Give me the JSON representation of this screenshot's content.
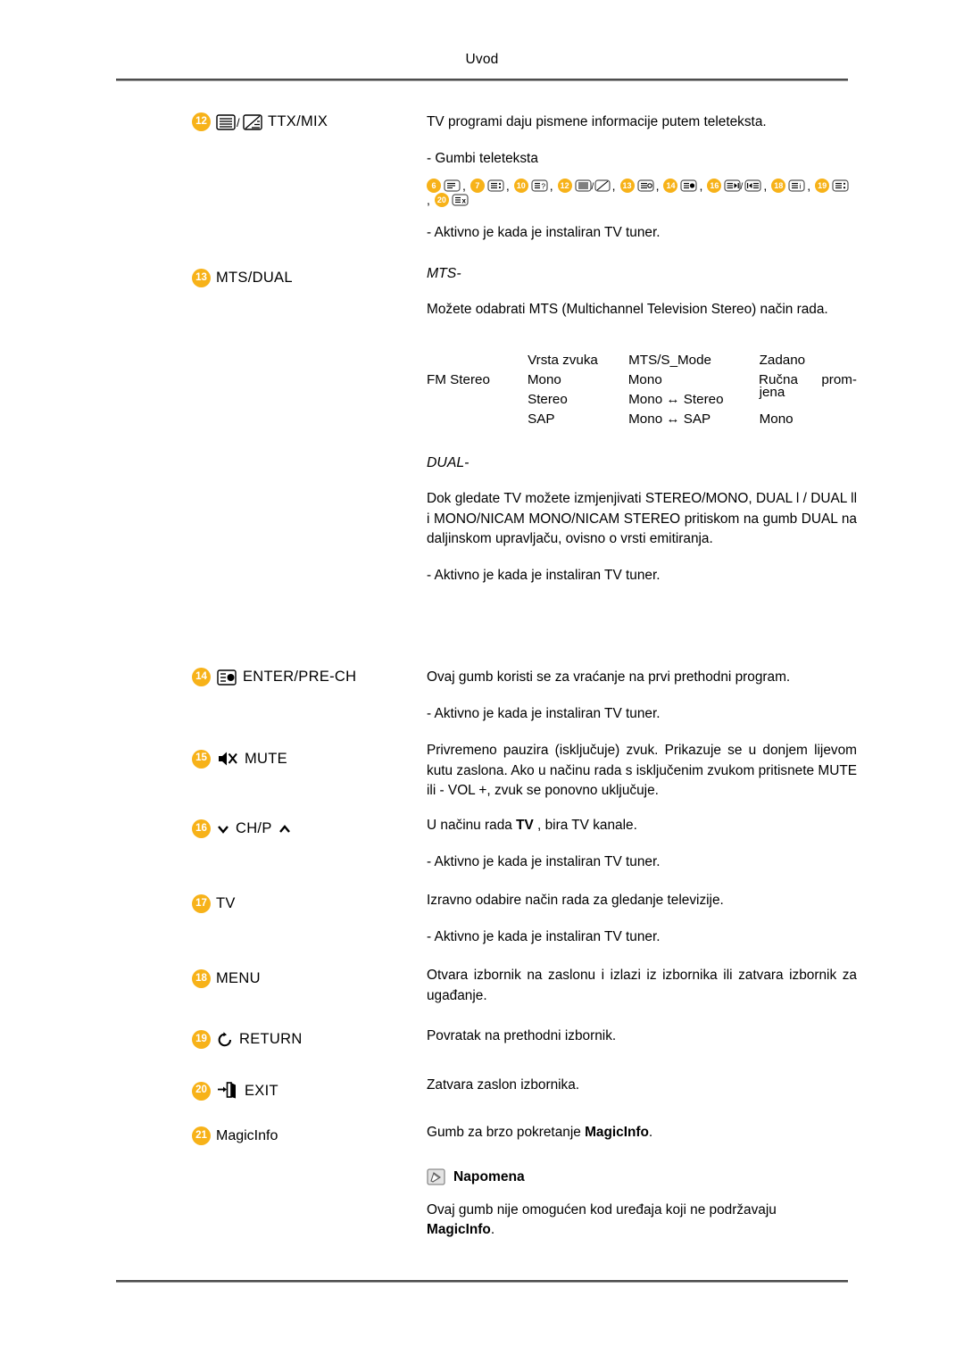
{
  "header": {
    "title": "Uvod"
  },
  "rows": [
    {
      "num": "12",
      "label": "TTX/MIX",
      "icon": "teletext-mix-icon",
      "desc_1": "TV programi daju pismene informacije putem teleteksta.",
      "desc_2": "- Gumbi teleteksta",
      "teletext_buttons": [
        {
          "num": "6",
          "icon": "teletext-index-icon"
        },
        {
          "num": "7",
          "icon": "teletext-size-icon"
        },
        {
          "num": "10",
          "icon": "teletext-reveal-icon"
        },
        {
          "num": "12",
          "icon": "teletext-mix-icon"
        },
        {
          "num": "13",
          "icon": "teletext-hold-icon"
        },
        {
          "num": "14",
          "icon": "teletext-subpage-icon"
        },
        {
          "num": "16",
          "icon": "teletext-page-next-icon"
        },
        {
          "num": "18",
          "icon": "teletext-info-icon"
        },
        {
          "num": "19",
          "icon": "teletext-store-icon"
        },
        {
          "num": "20",
          "icon": "teletext-cancel-icon"
        }
      ],
      "desc_3": "- Aktivno je kada je instaliran TV tuner."
    },
    {
      "num": "13",
      "label": "MTS/DUAL",
      "mts_title": "MTS-",
      "mts_desc": "Možete odabrati MTS (Multichannel Television Stereo) način rada.",
      "dual_title": "DUAL-",
      "dual_desc": "Dok gledate TV možete izmjenjivati STEREO/MONO, DUAL l / DUAL ll i MONO/NICAM MONO/NICAM STEREO pritiskom na gumb DUAL na daljinskom upravljaču, ovisno o vrsti emitiranja.",
      "desc_3": "- Aktivno je kada je instaliran TV tuner."
    },
    {
      "num": "14",
      "label": "ENTER/PRE-CH",
      "icon": "enter-prech-icon",
      "desc_1": "Ovaj gumb koristi se za vraćanje na prvi prethodni program.",
      "desc_3": "- Aktivno je kada je instaliran TV tuner."
    },
    {
      "num": "15",
      "label": "MUTE",
      "icon": "mute-icon",
      "desc_1": "Privremeno pauzira (isključuje) zvuk. Prikazuje se u donjem lijevom kutu zaslona. Ako u načinu rada s isključenim zvukom pritisnete MUTE ili - VOL +, zvuk se ponovno uključuje."
    },
    {
      "num": "16",
      "label": "CH/P",
      "icon": "channel-up-down-icon",
      "desc_pre": "U načinu rada ",
      "desc_bold": "TV",
      "desc_post": " , bira TV kanale.",
      "desc_3": "- Aktivno je kada je instaliran TV tuner."
    },
    {
      "num": "17",
      "label": "TV",
      "desc_1": "Izravno odabire način rada za gledanje televizije.",
      "desc_3": "- Aktivno je kada je instaliran TV tuner."
    },
    {
      "num": "18",
      "label": "MENU",
      "desc_1": "Otvara izbornik na zaslonu i izlazi iz izbornika ili zatvara izbornik za ugađanje."
    },
    {
      "num": "19",
      "label": "RETURN",
      "icon": "return-arrow-icon",
      "desc_1": "Povratak na prethodni izbornik."
    },
    {
      "num": "20",
      "label": "EXIT",
      "icon": "exit-door-icon",
      "desc_1": "Zatvara zaslon izbornika."
    },
    {
      "num": "21",
      "label": "MagicInfo",
      "desc_pre": "Gumb za brzo pokretanje ",
      "desc_bold": "MagicInfo",
      "desc_post": "."
    }
  ],
  "mts_table": {
    "headers": [
      "",
      "Vrsta zvuka",
      "MTS/S_Mode",
      "Zadano"
    ],
    "rows": [
      {
        "c0": "FM Stereo",
        "c1": "Mono",
        "c2": "Mono",
        "c3a": "Ručna",
        "c3b": "prom-"
      },
      {
        "c0": "",
        "c1": "Stereo",
        "c2": "Mono ↔ Stereo",
        "c3a": "jena",
        "c3b": ""
      },
      {
        "c0": "",
        "c1": "SAP",
        "c2": "Mono ↔ SAP",
        "c3a": "Mono",
        "c3b": ""
      }
    ]
  },
  "note": {
    "icon": "note-pencil-icon",
    "title": "Napomena",
    "body_pre": "Ovaj gumb nije omogućen kod uređaja koji ne podržavaju ",
    "body_bold": "MagicInfo",
    "body_post": "."
  },
  "colors": {
    "badge": "#f7b219",
    "rule": "#4d4d4d",
    "text": "#000000"
  }
}
